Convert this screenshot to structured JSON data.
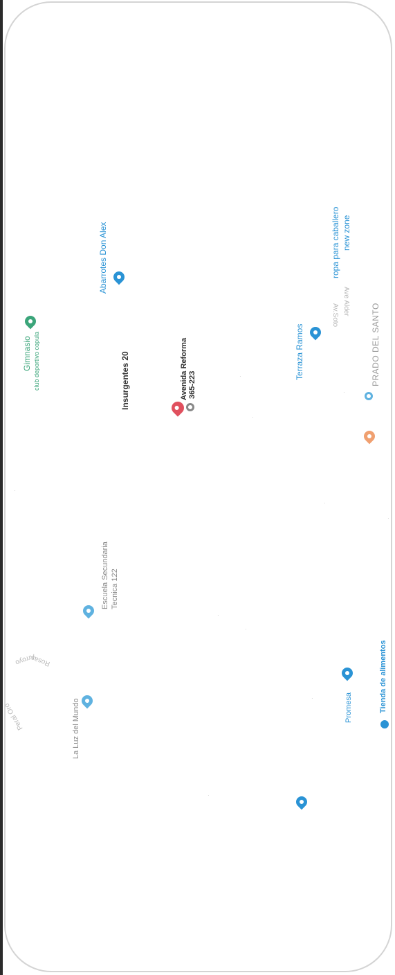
{
  "colors": {
    "green": "#3ba57a",
    "blue": "#2a93d5",
    "light_blue": "#5fb2e0",
    "red": "#e0505e",
    "orange": "#f0a070",
    "dark": "#333333",
    "grey": "#9a9a9a"
  },
  "map": {
    "places": {
      "gimnasio": {
        "name": "Gimnasio",
        "sub": "club deportivo copula"
      },
      "abarrotes": {
        "name": "Abarrotes Don Alex"
      },
      "insurgentes": {
        "name": "Insurgentes 20"
      },
      "avenida": {
        "name": "Avenida Reforma",
        "sub": "365-223"
      },
      "terraza": {
        "name": "Terraza Ramos"
      },
      "ropa": {
        "name": "ropa para caballero",
        "sub": "new zone"
      },
      "prado": {
        "name": "PRADO DEL SANTO"
      },
      "escuela": {
        "name": "Escuela Secundaria",
        "sub": "Tecnica 122"
      },
      "luz": {
        "name": "La Luz del Mundo"
      },
      "promesa": {
        "name": "Promesa"
      },
      "tienda": {
        "name": "Tienda de alimentos"
      }
    },
    "streets": {
      "s1": "Av.Soto",
      "s2": "Ave Alder",
      "s3": "Arroyo",
      "s4": "Peral Oro",
      "s5": "Rosas"
    }
  }
}
